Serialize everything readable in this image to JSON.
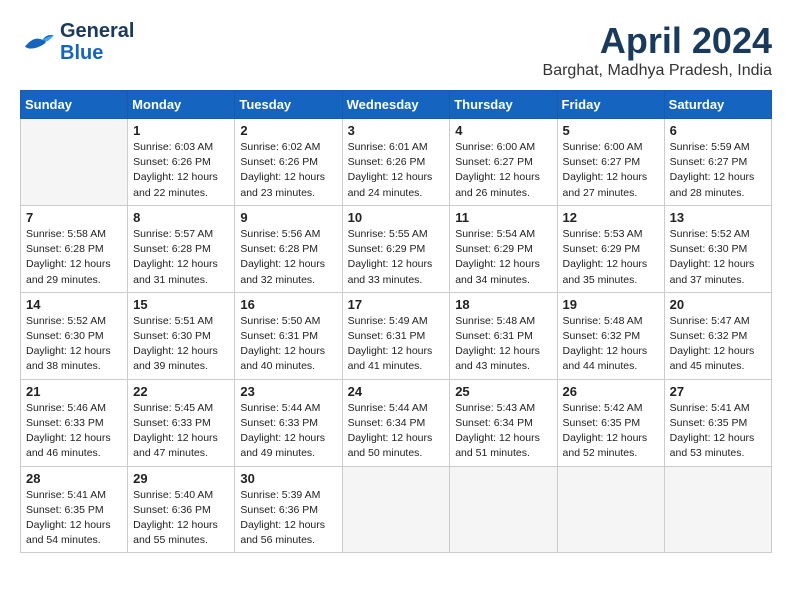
{
  "header": {
    "logo_line1": "General",
    "logo_line2": "Blue",
    "title": "April 2024",
    "subtitle": "Barghat, Madhya Pradesh, India"
  },
  "calendar": {
    "days_of_week": [
      "Sunday",
      "Monday",
      "Tuesday",
      "Wednesday",
      "Thursday",
      "Friday",
      "Saturday"
    ],
    "weeks": [
      [
        {
          "day": "",
          "info": ""
        },
        {
          "day": "1",
          "info": "Sunrise: 6:03 AM\nSunset: 6:26 PM\nDaylight: 12 hours\nand 22 minutes."
        },
        {
          "day": "2",
          "info": "Sunrise: 6:02 AM\nSunset: 6:26 PM\nDaylight: 12 hours\nand 23 minutes."
        },
        {
          "day": "3",
          "info": "Sunrise: 6:01 AM\nSunset: 6:26 PM\nDaylight: 12 hours\nand 24 minutes."
        },
        {
          "day": "4",
          "info": "Sunrise: 6:00 AM\nSunset: 6:27 PM\nDaylight: 12 hours\nand 26 minutes."
        },
        {
          "day": "5",
          "info": "Sunrise: 6:00 AM\nSunset: 6:27 PM\nDaylight: 12 hours\nand 27 minutes."
        },
        {
          "day": "6",
          "info": "Sunrise: 5:59 AM\nSunset: 6:27 PM\nDaylight: 12 hours\nand 28 minutes."
        }
      ],
      [
        {
          "day": "7",
          "info": "Sunrise: 5:58 AM\nSunset: 6:28 PM\nDaylight: 12 hours\nand 29 minutes."
        },
        {
          "day": "8",
          "info": "Sunrise: 5:57 AM\nSunset: 6:28 PM\nDaylight: 12 hours\nand 31 minutes."
        },
        {
          "day": "9",
          "info": "Sunrise: 5:56 AM\nSunset: 6:28 PM\nDaylight: 12 hours\nand 32 minutes."
        },
        {
          "day": "10",
          "info": "Sunrise: 5:55 AM\nSunset: 6:29 PM\nDaylight: 12 hours\nand 33 minutes."
        },
        {
          "day": "11",
          "info": "Sunrise: 5:54 AM\nSunset: 6:29 PM\nDaylight: 12 hours\nand 34 minutes."
        },
        {
          "day": "12",
          "info": "Sunrise: 5:53 AM\nSunset: 6:29 PM\nDaylight: 12 hours\nand 35 minutes."
        },
        {
          "day": "13",
          "info": "Sunrise: 5:52 AM\nSunset: 6:30 PM\nDaylight: 12 hours\nand 37 minutes."
        }
      ],
      [
        {
          "day": "14",
          "info": "Sunrise: 5:52 AM\nSunset: 6:30 PM\nDaylight: 12 hours\nand 38 minutes."
        },
        {
          "day": "15",
          "info": "Sunrise: 5:51 AM\nSunset: 6:30 PM\nDaylight: 12 hours\nand 39 minutes."
        },
        {
          "day": "16",
          "info": "Sunrise: 5:50 AM\nSunset: 6:31 PM\nDaylight: 12 hours\nand 40 minutes."
        },
        {
          "day": "17",
          "info": "Sunrise: 5:49 AM\nSunset: 6:31 PM\nDaylight: 12 hours\nand 41 minutes."
        },
        {
          "day": "18",
          "info": "Sunrise: 5:48 AM\nSunset: 6:31 PM\nDaylight: 12 hours\nand 43 minutes."
        },
        {
          "day": "19",
          "info": "Sunrise: 5:48 AM\nSunset: 6:32 PM\nDaylight: 12 hours\nand 44 minutes."
        },
        {
          "day": "20",
          "info": "Sunrise: 5:47 AM\nSunset: 6:32 PM\nDaylight: 12 hours\nand 45 minutes."
        }
      ],
      [
        {
          "day": "21",
          "info": "Sunrise: 5:46 AM\nSunset: 6:33 PM\nDaylight: 12 hours\nand 46 minutes."
        },
        {
          "day": "22",
          "info": "Sunrise: 5:45 AM\nSunset: 6:33 PM\nDaylight: 12 hours\nand 47 minutes."
        },
        {
          "day": "23",
          "info": "Sunrise: 5:44 AM\nSunset: 6:33 PM\nDaylight: 12 hours\nand 49 minutes."
        },
        {
          "day": "24",
          "info": "Sunrise: 5:44 AM\nSunset: 6:34 PM\nDaylight: 12 hours\nand 50 minutes."
        },
        {
          "day": "25",
          "info": "Sunrise: 5:43 AM\nSunset: 6:34 PM\nDaylight: 12 hours\nand 51 minutes."
        },
        {
          "day": "26",
          "info": "Sunrise: 5:42 AM\nSunset: 6:35 PM\nDaylight: 12 hours\nand 52 minutes."
        },
        {
          "day": "27",
          "info": "Sunrise: 5:41 AM\nSunset: 6:35 PM\nDaylight: 12 hours\nand 53 minutes."
        }
      ],
      [
        {
          "day": "28",
          "info": "Sunrise: 5:41 AM\nSunset: 6:35 PM\nDaylight: 12 hours\nand 54 minutes."
        },
        {
          "day": "29",
          "info": "Sunrise: 5:40 AM\nSunset: 6:36 PM\nDaylight: 12 hours\nand 55 minutes."
        },
        {
          "day": "30",
          "info": "Sunrise: 5:39 AM\nSunset: 6:36 PM\nDaylight: 12 hours\nand 56 minutes."
        },
        {
          "day": "",
          "info": ""
        },
        {
          "day": "",
          "info": ""
        },
        {
          "day": "",
          "info": ""
        },
        {
          "day": "",
          "info": ""
        }
      ]
    ]
  }
}
